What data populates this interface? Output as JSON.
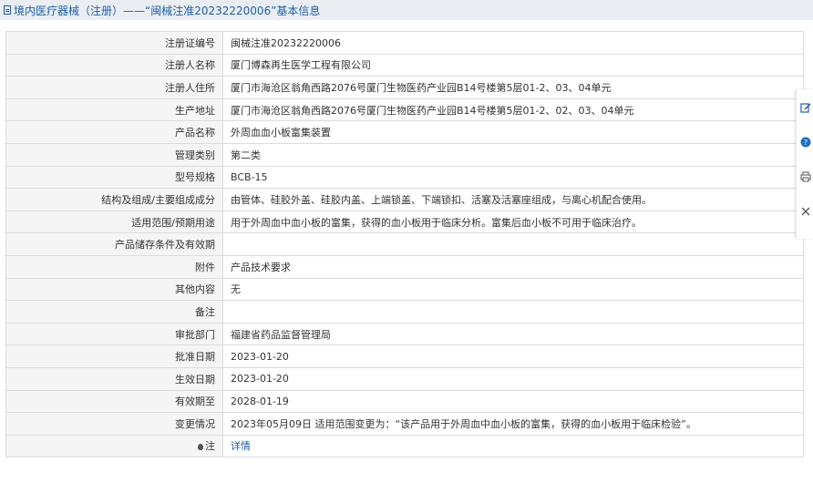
{
  "header": {
    "title": "境内医疗器械（注册）——“闽械注准20232220006”基本信息"
  },
  "rows": [
    {
      "label": "注册证编号",
      "value": "闽械注准20232220006"
    },
    {
      "label": "注册人名称",
      "value": "厦门博森再生医学工程有限公司"
    },
    {
      "label": "注册人住所",
      "value": "厦门市海沧区翁角西路2076号厦门生物医药产业园B14号楼第5层01-2、03、04单元"
    },
    {
      "label": "生产地址",
      "value": "厦门市海沧区翁角西路2076号厦门生物医药产业园B14号楼第5层01-2、02、03、04单元"
    },
    {
      "label": "产品名称",
      "value": "外周血血小板富集装置"
    },
    {
      "label": "管理类别",
      "value": "第二类"
    },
    {
      "label": "型号规格",
      "value": "BCB-15"
    },
    {
      "label": "结构及组成/主要组成成分",
      "value": "由管体、硅胶外盖、硅胶内盖、上端锁盖、下端锁扣、活塞及活塞座组成，与离心机配合使用。"
    },
    {
      "label": "适用范围/预期用途",
      "value": "用于外周血中血小板的富集，获得的血小板用于临床分析。富集后血小板不可用于临床治疗。"
    },
    {
      "label": "产品储存条件及有效期",
      "value": ""
    },
    {
      "label": "附件",
      "value": "产品技术要求"
    },
    {
      "label": "其他内容",
      "value": "无"
    },
    {
      "label": "备注",
      "value": ""
    },
    {
      "label": "审批部门",
      "value": "福建省药品监督管理局"
    },
    {
      "label": "批准日期",
      "value": "2023-01-20"
    },
    {
      "label": "生效日期",
      "value": "2023-01-20"
    },
    {
      "label": "有效期至",
      "value": "2028-01-19"
    },
    {
      "label": "变更情况",
      "value": "2023年05月09日 适用范围变更为：“该产品用于外周血中血小板的富集，获得的血小板用于临床检验”。"
    }
  ],
  "note_row": {
    "label": "注",
    "link": "详情"
  },
  "sidebar": {
    "icons": [
      "edit-icon",
      "help-icon",
      "print-icon",
      "close-icon"
    ],
    "help_glyph": "?"
  },
  "colors": {
    "header_bg": "#eaeef3",
    "link": "#1f5fa8",
    "label_bg": "#f5f5f5",
    "border": "#dcdcdc"
  }
}
